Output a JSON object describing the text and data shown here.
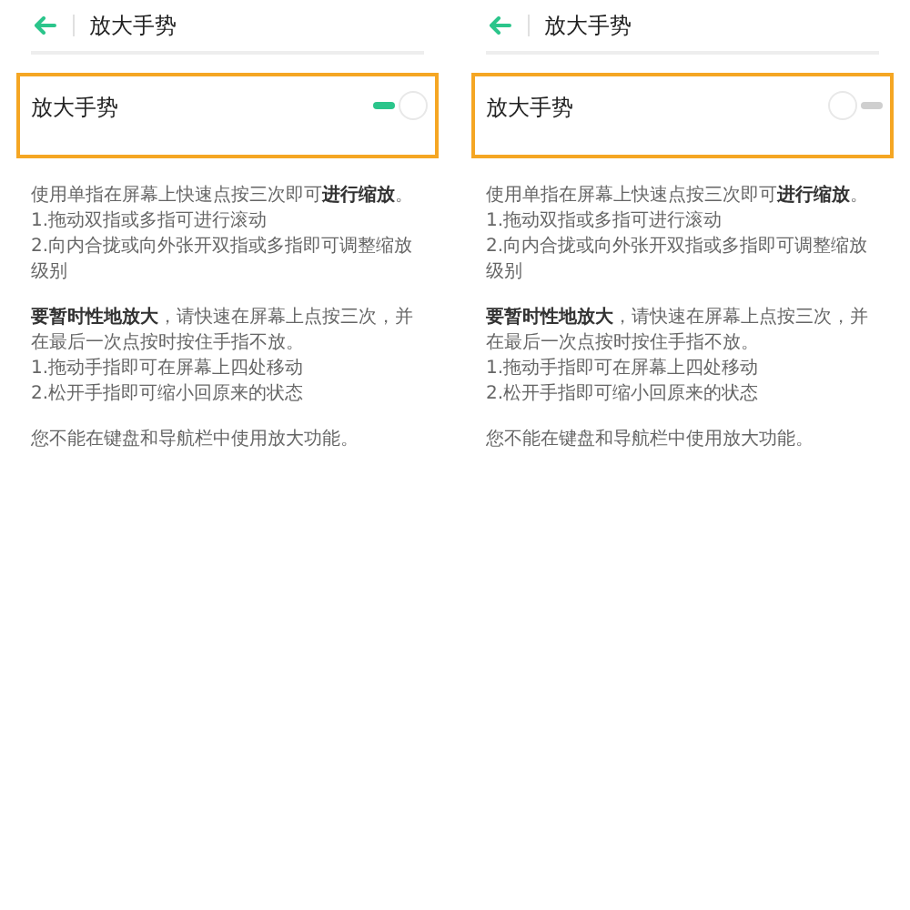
{
  "panels": [
    {
      "header": {
        "title": "放大手势"
      },
      "setting": {
        "label": "放大手势",
        "on": true
      },
      "description": [
        [
          "使用单指在屏幕上快速点按三次即可**进行缩放**。",
          "1.拖动双指或多指可进行滚动",
          "2.向内合拢或向外张开双指或多指即可调整缩放级别"
        ],
        [
          "**要暂时性地放大**，请快速在屏幕上点按三次，并在最后一次点按时按住手指不放。",
          "1.拖动手指即可在屏幕上四处移动",
          "2.松开手指即可缩小回原来的状态"
        ],
        [
          "您不能在键盘和导航栏中使用放大功能。"
        ]
      ]
    },
    {
      "header": {
        "title": "放大手势"
      },
      "setting": {
        "label": "放大手势",
        "on": false
      },
      "description": [
        [
          "使用单指在屏幕上快速点按三次即可**进行缩放**。",
          "1.拖动双指或多指可进行滚动",
          "2.向内合拢或向外张开双指或多指即可调整缩放级别"
        ],
        [
          "**要暂时性地放大**，请快速在屏幕上点按三次，并在最后一次点按时按住手指不放。",
          "1.拖动手指即可在屏幕上四处移动",
          "2.松开手指即可缩小回原来的状态"
        ],
        [
          "您不能在键盘和导航栏中使用放大功能。"
        ]
      ]
    }
  ]
}
